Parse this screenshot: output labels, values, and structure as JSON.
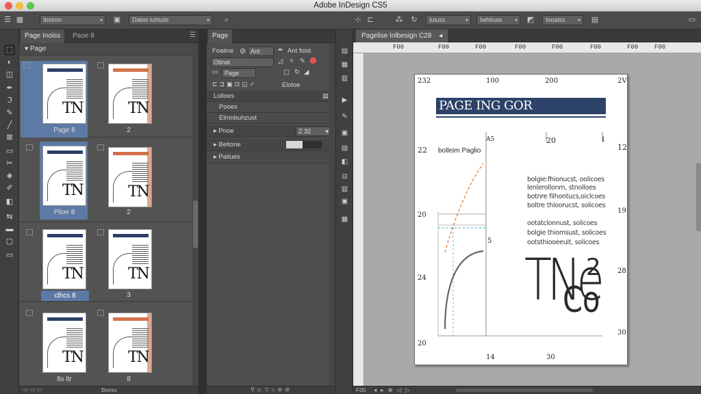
{
  "app": {
    "window_title": "Adobe InDesign CS5"
  },
  "controlbar": {
    "field1": "Iboinm",
    "field2": "Dabio luhiuiis",
    "field3": "Iuiuss",
    "field4": "Iwhiluas",
    "field5": "Iooalss"
  },
  "pages_panel": {
    "tabs": [
      "Page Inoiss",
      "Paoe 8"
    ],
    "section_label": "Page",
    "spreads": [
      {
        "left_label": "Page 8",
        "right_label": "2"
      },
      {
        "left_label": "Plioe 8",
        "right_label": "2"
      },
      {
        "left_label": "clhcs 8",
        "right_label": "3"
      },
      {
        "left_label": "8s ltr",
        "right_label": "8"
      }
    ]
  },
  "page_panel": {
    "tab": "Page",
    "row1": {
      "label": "Foaiine",
      "field": "Ant",
      "field2": "Ant foist"
    },
    "row2": {
      "field": "Otinat"
    },
    "row3": {
      "field": "Page"
    },
    "row4": {
      "label": "Eloloe"
    },
    "strips": [
      "Lolloes",
      "Pooes",
      "Elmnbuhzust"
    ],
    "page_label": "Pnoe",
    "page_value": "Z 32",
    "beltone_label": "Beltone",
    "pailues_label": "Pailues"
  },
  "document": {
    "tab_label": "Pagelise Inlbesign C28",
    "ruler_h_labels": [
      "F00",
      "F00",
      "F00",
      "F00",
      "F00",
      "F00",
      "F00",
      "F00",
      "F00",
      "F00"
    ],
    "ruler_v_labels": [
      "",
      "",
      "",
      "",
      "",
      "",
      "",
      "",
      ""
    ],
    "headline": "PAGE ING GOR",
    "corner_numbers": {
      "top_left": "232",
      "top_center": "100",
      "top_right_a": "200",
      "top_right_b": "2V"
    },
    "subhead": "bolleim Paglio",
    "col_marks": [
      "A5",
      "20",
      "1"
    ],
    "margin_numbers_left": [
      "22",
      "20",
      "24",
      "20"
    ],
    "margin_numbers_right": [
      "12",
      "19",
      "28",
      "30"
    ],
    "bottom_numbers": [
      "14",
      "30"
    ],
    "mid_number": "5",
    "body_lines": [
      "bolgie:fhionucst, oolicoes",
      "lenlerollonm, stnolloes",
      "botnre filhontucs,oiclcoes",
      "boltre thloorucst, solicoes",
      "ootatclonnust, solicoes",
      "bolgie thiomsust, solicoes",
      "ootsthiooeeuit, solicoes"
    ],
    "big_text": "TNe",
    "big_superscript": "2",
    "big_second_line": "Co"
  },
  "status": {
    "left": "F00",
    "middle": "Bemu"
  },
  "colors": {
    "accent": "#5d7aa6",
    "headline_bg": "#2d4269",
    "orange_guide": "#e07a3a",
    "cyan_guide": "#5bbcd6"
  }
}
